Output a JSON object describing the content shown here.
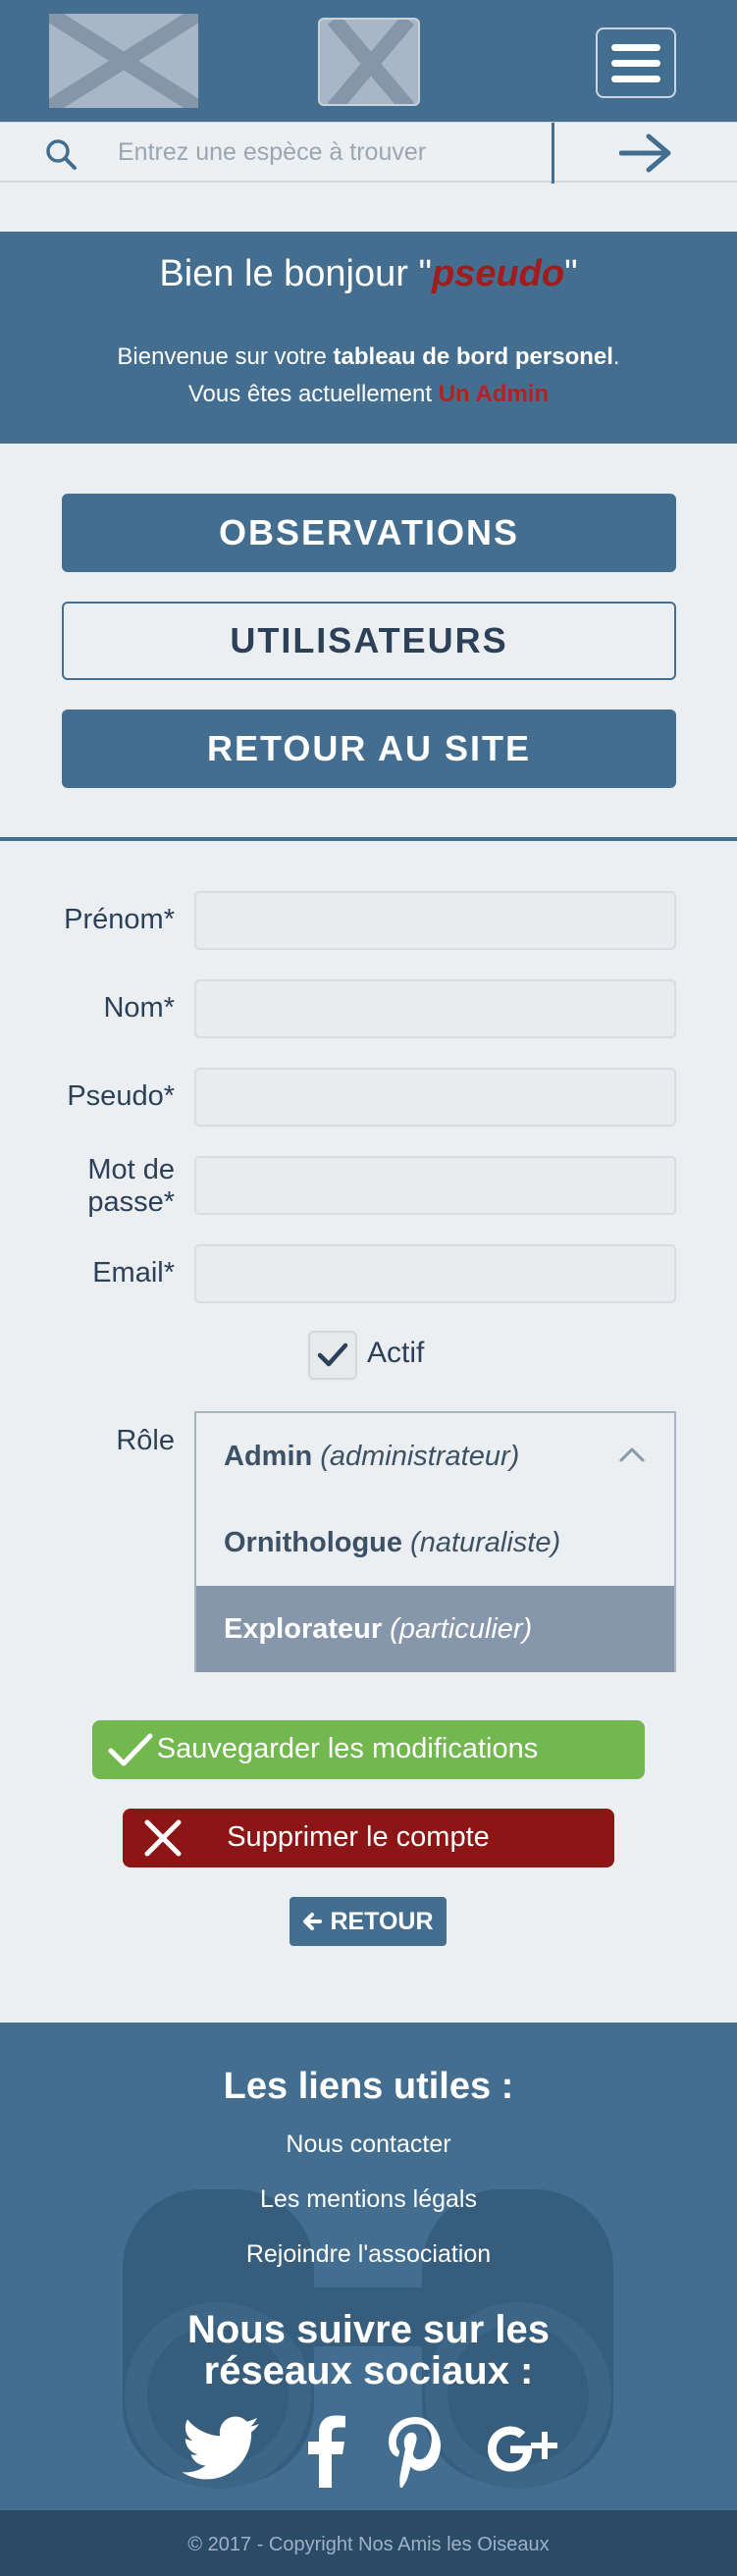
{
  "search": {
    "placeholder": "Entrez une espèce à trouver"
  },
  "welcome": {
    "title_prefix": "Bien le bonjour \"",
    "pseudo": "pseudo",
    "title_suffix": "\"",
    "line1_prefix": "Bienvenue sur votre ",
    "line1_bold": "tableau de bord personel",
    "line1_suffix": ".",
    "line2_prefix": "Vous êtes actuellement ",
    "role": "Un Admin"
  },
  "nav": {
    "observations": "OBSERVATIONS",
    "utilisateurs": "UTILISATEURS",
    "retour_site": "RETOUR AU SITE"
  },
  "form": {
    "prenom_label": "Prénom*",
    "nom_label": "Nom*",
    "pseudo_label": "Pseudo*",
    "password_label_1": "Mot de",
    "password_label_2": "passe*",
    "email_label": "Email*",
    "actif_label": "Actif",
    "actif_checked": true,
    "role_label": "Rôle",
    "roles": [
      {
        "name": "Admin",
        "desc": "(administrateur)"
      },
      {
        "name": "Ornithologue",
        "desc": "(naturaliste)"
      },
      {
        "name": "Explorateur",
        "desc": "(particulier)"
      }
    ],
    "save_label": "Sauvegarder les modifications",
    "delete_label": "Supprimer le compte",
    "back_label": "RETOUR"
  },
  "footer": {
    "links_title": "Les liens utiles :",
    "links": [
      "Nous contacter",
      "Les mentions légals",
      "Rejoindre l'association"
    ],
    "social_title_1": "Nous suivre sur les",
    "social_title_2": "réseaux sociaux :",
    "social": [
      "twitter-icon",
      "facebook-icon",
      "pinterest-icon",
      "google-plus-icon"
    ],
    "copyright": "© 2017 - Copyright Nos Amis les Oiseaux"
  },
  "colors": {
    "primary": "#436e90",
    "accent_red": "#a11c1c",
    "save_green": "#73b74f",
    "delete_red": "#8c1515"
  }
}
